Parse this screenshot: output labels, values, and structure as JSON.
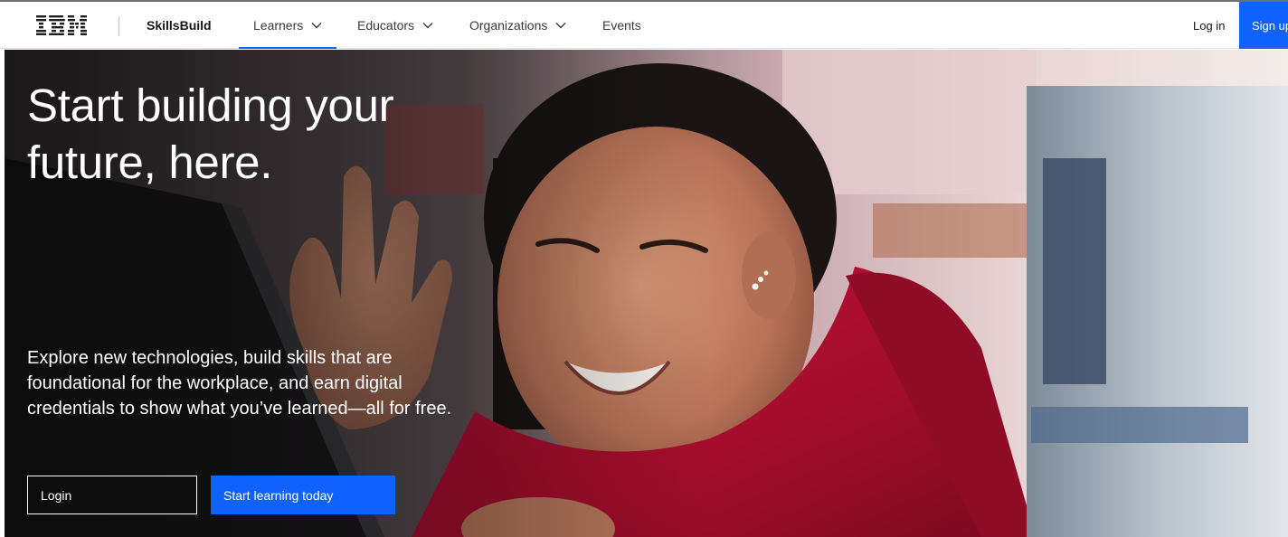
{
  "nav": {
    "logo_text": "IBM",
    "brand": "SkillsBuild",
    "items": [
      {
        "label": "Learners",
        "has_dropdown": true,
        "active": true
      },
      {
        "label": "Educators",
        "has_dropdown": true,
        "active": false
      },
      {
        "label": "Organizations",
        "has_dropdown": true,
        "active": false
      },
      {
        "label": "Events",
        "has_dropdown": false,
        "active": false
      }
    ],
    "login_label": "Log in",
    "signup_label": "Sign up"
  },
  "hero": {
    "title_line1": "Start building your",
    "title_line2": "future, here.",
    "description": "Explore new technologies, build skills that are foundational for the workplace, and earn digital credentials to show what you’ve learned—all for free.",
    "login_button": "Login",
    "cta_button": "Start learning today",
    "image": "smiling-student-waving-at-laptop"
  },
  "colors": {
    "accent": "#0f62fe",
    "text_dark": "#161616",
    "nav_text": "#393939",
    "hero_text": "#ffffff",
    "sweater_red": "#b3102e"
  }
}
